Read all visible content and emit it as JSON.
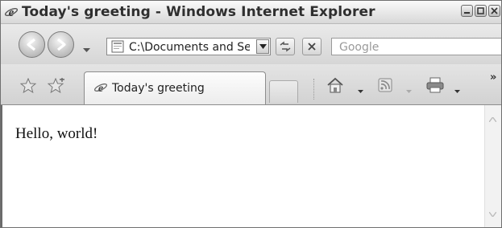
{
  "window": {
    "title": "Today's greeting - Windows Internet Explorer",
    "controls": [
      "minimize",
      "maximize",
      "close"
    ]
  },
  "address_bar": {
    "url": "C:\\Documents and Se",
    "search_placeholder": "Google"
  },
  "tabs": [
    {
      "label": "Today's greeting",
      "icon": "ie-icon",
      "active": true
    }
  ],
  "toolbar": {
    "items": [
      "home-icon",
      "feeds-icon",
      "print-icon"
    ],
    "more_label": "»"
  },
  "page": {
    "text": "Hello, world!"
  },
  "colors": {
    "chrome": "#dcdcdc",
    "content_bg": "#ffffff"
  }
}
